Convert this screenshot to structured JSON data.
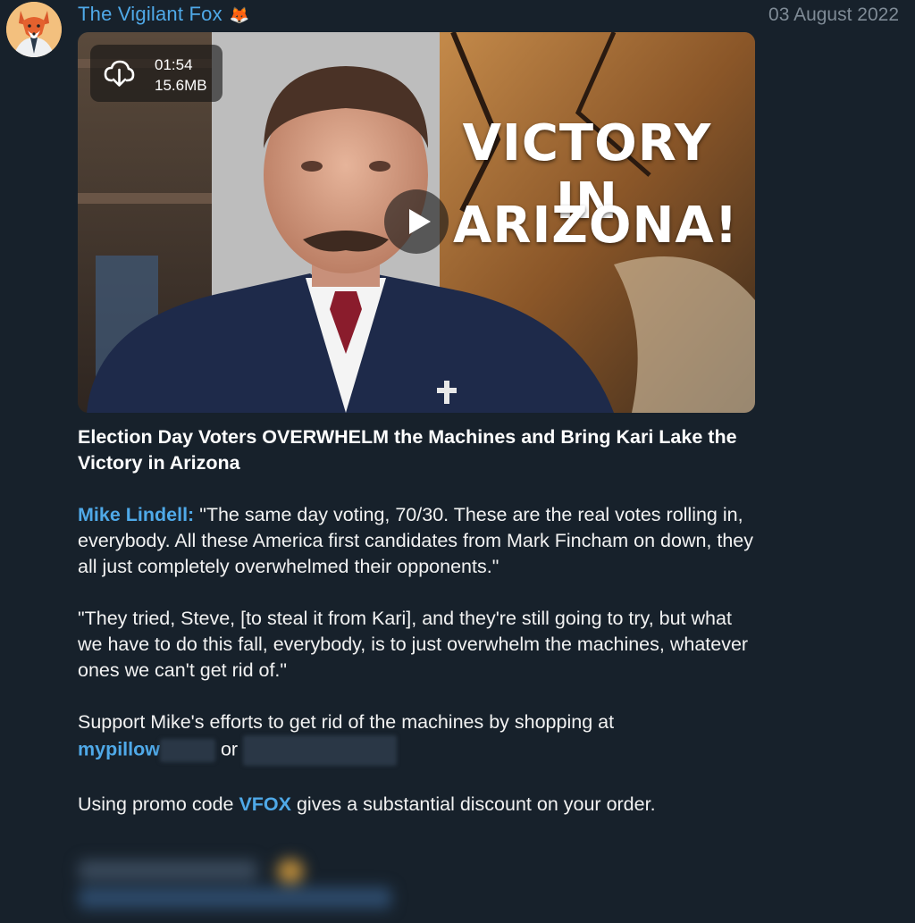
{
  "channel": {
    "name": "The Vigilant Fox",
    "emoji": "🦊",
    "avatar_icon": "fox-avatar-icon"
  },
  "message": {
    "date": "03 August 2022",
    "video": {
      "duration": "01:54",
      "size": "15.6MB",
      "overlay_line1": "VICTORY IN",
      "overlay_line2": "ARIZONA!",
      "download_icon": "cloud-download-icon",
      "play_icon": "play-icon"
    },
    "title": "Election Day Voters OVERWHELM the Machines and Bring Kari Lake the Victory in Arizona",
    "quote1": {
      "speaker": "Mike Lindell:",
      "text": " \"The same day voting, 70/30. These are the real votes rolling in, everybody. All these America first candidates from Mark Fincham on down, they all just completely overwhelmed their opponents.\""
    },
    "quote2": "\"They tried, Steve, [to steal it from Kari], and they're still going to try, but what we have to do this fall, everybody, is to just overwhelm the machines, whatever ones we can't get rid of.\"",
    "support": {
      "text": "Support Mike's efforts to get rid of the machines by shopping at",
      "link": "mypillow",
      "or": "or"
    },
    "promo": {
      "before": "Using promo code ",
      "code": "VFOX",
      "after": " gives a substantial discount on your order."
    }
  },
  "colors": {
    "background": "#17212b",
    "link": "#4fa9e8",
    "date": "#7f8b96"
  }
}
